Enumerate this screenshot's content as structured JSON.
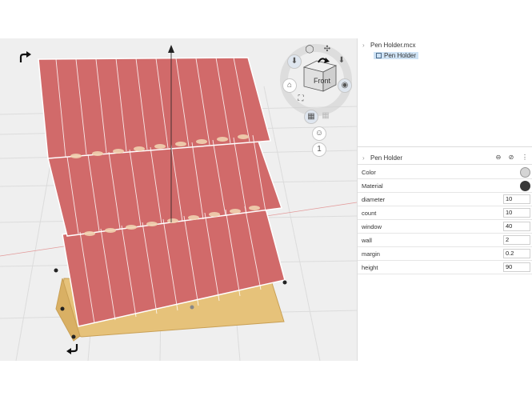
{
  "tree": {
    "root_label": "Pen Holder.mcx",
    "child_label": "Pen Holder"
  },
  "properties": {
    "header_title": "Pen Holder",
    "rows": [
      {
        "label": "Color",
        "kind": "swatch",
        "swatch": "#d4d4d4"
      },
      {
        "label": "Material",
        "kind": "swatch",
        "swatch": "#3a3a3a"
      },
      {
        "label": "diameter",
        "kind": "value",
        "value": "10"
      },
      {
        "label": "count",
        "kind": "value",
        "value": "10"
      },
      {
        "label": "window",
        "kind": "value",
        "value": "40"
      },
      {
        "label": "wall",
        "kind": "value",
        "value": "2"
      },
      {
        "label": "margin",
        "kind": "value",
        "value": "0.2"
      },
      {
        "label": "height",
        "kind": "value",
        "value": "90"
      }
    ]
  },
  "navcube": {
    "face_label": "Front",
    "view_button_label": "1"
  },
  "colors": {
    "model_fill": "#d16a6a",
    "model_edge": "#ffffff",
    "base_fill": "#e6c27a",
    "viewport_bg": "#efefef",
    "selection": "#cfe3f5"
  },
  "icons": {
    "rotate_top": "rotate-arrow-icon",
    "rotate_bottom": "rotate-arrow-icon",
    "header_actions": [
      "hide-icon",
      "lock-icon",
      "more-icon"
    ]
  }
}
